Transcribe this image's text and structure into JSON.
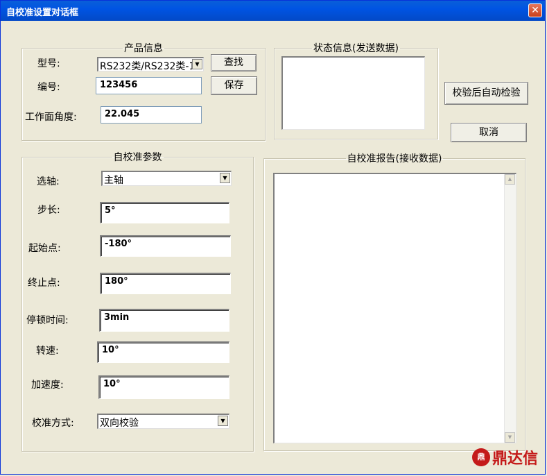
{
  "window": {
    "title": "自校准设置对话框",
    "close_label": "✕"
  },
  "product_info": {
    "legend": "产品信息",
    "model_label": "型号:",
    "model_value": "RS232类/RS232类-1",
    "serial_label": "编号:",
    "serial_value": "123456",
    "angle_label": "工作面角度:",
    "angle_value": "22.045",
    "find_button": "查找",
    "save_button": "保存"
  },
  "status_info": {
    "legend": "状态信息(发送数据)"
  },
  "actions": {
    "auto_verify_button": "校验后自动检验",
    "cancel_button": "取消"
  },
  "params": {
    "legend": "自校准参数",
    "axis_label": "选轴:",
    "axis_value": "主轴",
    "step_label": "步长:",
    "step_value": "5°",
    "start_label": "起始点:",
    "start_value": "-180°",
    "end_label": "终止点:",
    "end_value": "180°",
    "pause_label": "停顿时间:",
    "pause_value": "3min",
    "speed_label": "转速:",
    "speed_value": "10°",
    "accel_label": "加速度:",
    "accel_value": "10°",
    "mode_label": "校准方式:",
    "mode_value": "双向校验"
  },
  "report": {
    "legend": "自校准报告(接收数据)"
  },
  "watermark": {
    "text": "鼎达信",
    "mark": "鼎"
  },
  "colors": {
    "title_bar": "#0054e3",
    "dialog_bg": "#ece9d8",
    "logo_red": "#c41a1a"
  }
}
